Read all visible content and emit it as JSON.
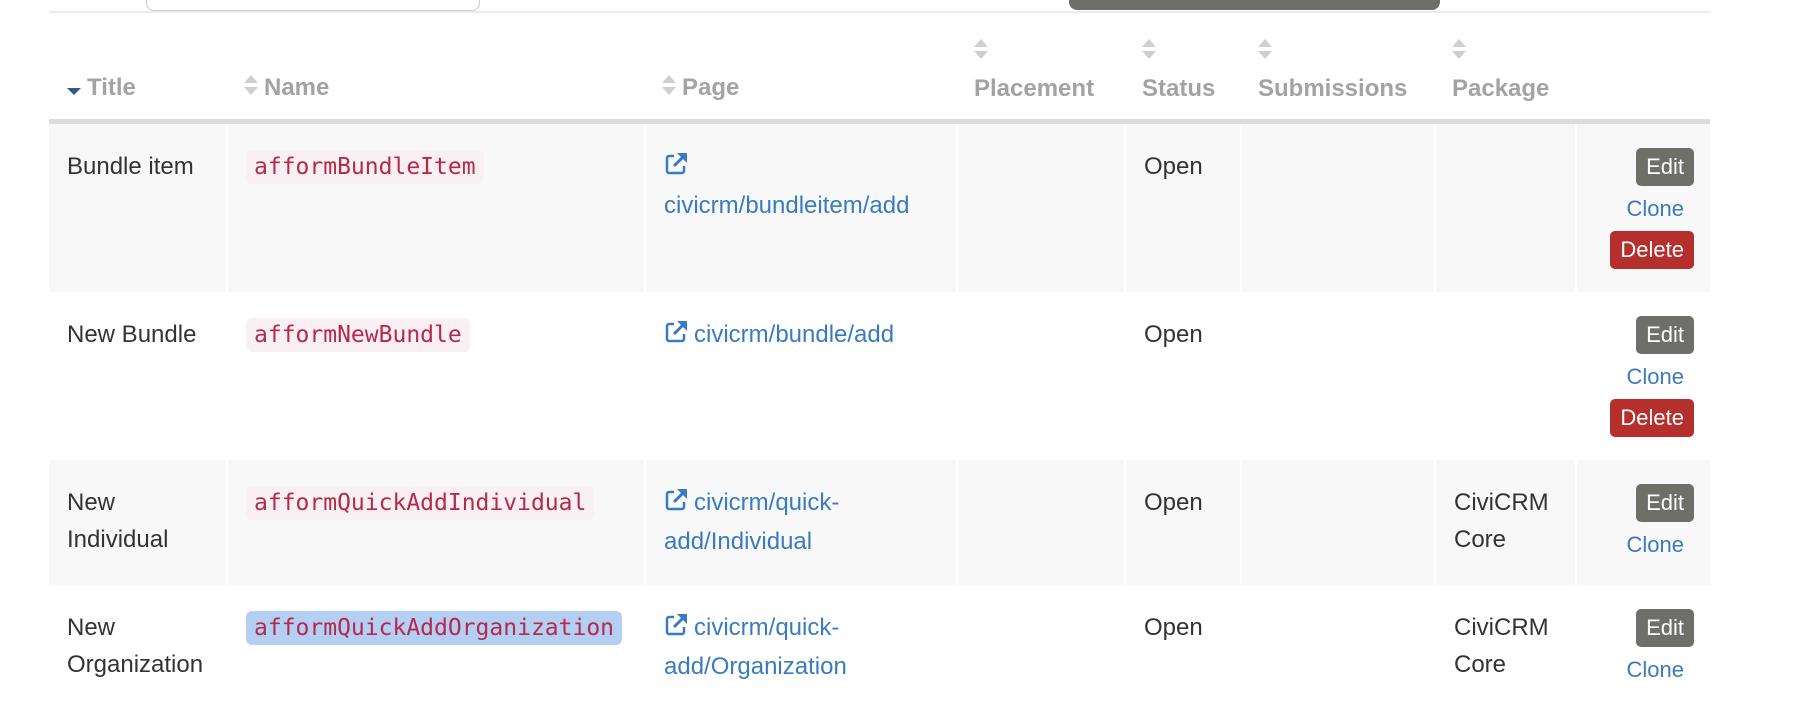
{
  "table": {
    "columns": [
      {
        "label": "Title",
        "sort": "descending"
      },
      {
        "label": "Name",
        "sort": "none"
      },
      {
        "label": "Page",
        "sort": "none"
      },
      {
        "label": "Placement",
        "sort": "none"
      },
      {
        "label": "Status",
        "sort": "none"
      },
      {
        "label": "Submissions",
        "sort": "none"
      },
      {
        "label": "Package",
        "sort": "none"
      },
      {
        "label": "",
        "sort": null
      }
    ],
    "rows": [
      {
        "title": "Bundle item",
        "name": "afformBundleItem",
        "page": "civicrm/bundleitem/add",
        "placement": "",
        "status": "Open",
        "submissions": "",
        "package": "",
        "actions": {
          "edit": "Edit",
          "clone": "Clone",
          "delete": "Delete"
        }
      },
      {
        "title": "New Bundle",
        "name": "afformNewBundle",
        "page": "civicrm/bundle/add",
        "placement": "",
        "status": "Open",
        "submissions": "",
        "package": "",
        "actions": {
          "edit": "Edit",
          "clone": "Clone",
          "delete": "Delete"
        }
      },
      {
        "title": "New Individual",
        "name": "afformQuickAddIndividual",
        "page": "civicrm/quick-add/Individual",
        "placement": "",
        "status": "Open",
        "submissions": "",
        "package": "CiviCRM Core",
        "actions": {
          "edit": "Edit",
          "clone": "Clone"
        }
      },
      {
        "title": "New Organization",
        "name": "afformQuickAddOrganization",
        "page": "civicrm/quick-add/Organization",
        "placement": "",
        "status": "Open",
        "submissions": "",
        "package": "CiviCRM Core",
        "actions": {
          "edit": "Edit",
          "clone": "Clone"
        },
        "name_selected": true
      }
    ]
  },
  "icons": {
    "sort_desc": "caret-down-icon",
    "sort": "sort-icon",
    "external": "external-link-icon"
  },
  "colors": {
    "link": "#3a7bbf",
    "edit": "#6f6f6a",
    "delete": "#b52f2c",
    "code": "#b7294b",
    "header": "#a3a3a3"
  }
}
